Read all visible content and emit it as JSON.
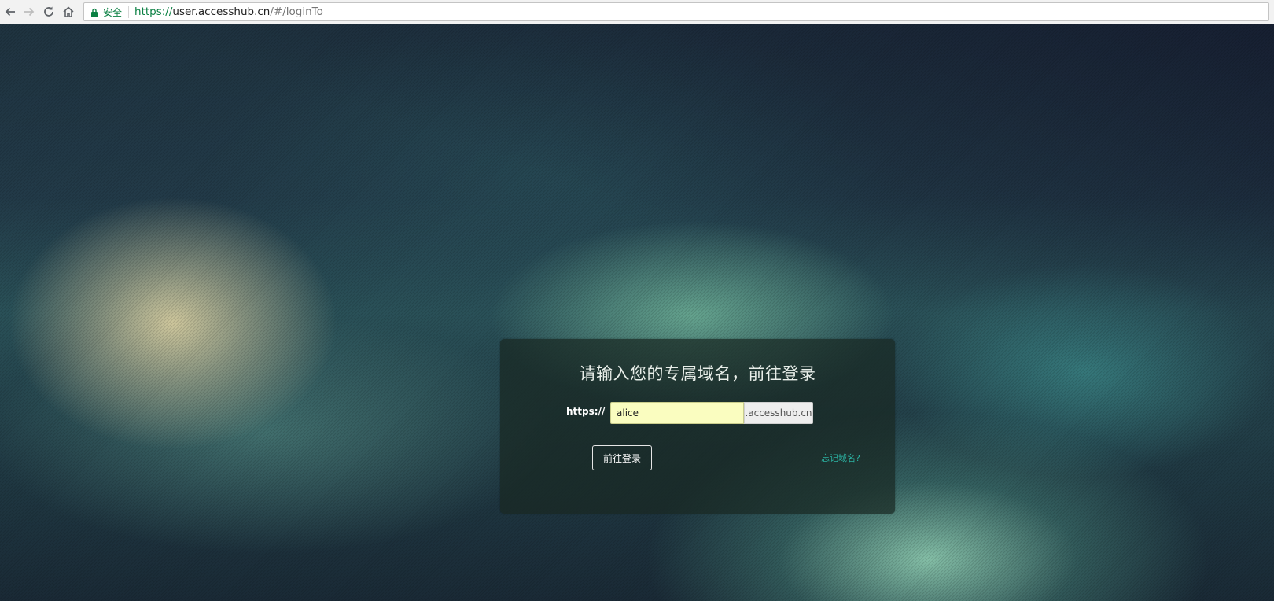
{
  "browser": {
    "secure_label": "安全",
    "url": {
      "scheme": "https://",
      "host": "user.accesshub.cn",
      "path": "/#/loginTo"
    },
    "icons": [
      "back-arrow-icon",
      "forward-arrow-icon",
      "reload-icon",
      "home-icon",
      "lock-icon"
    ],
    "secure_color": "#0b8043"
  },
  "login": {
    "title": "请输入您的专属域名，前往登录",
    "protocol_label": "https://",
    "domain_value": "alice",
    "domain_suffix": ".accesshub.cn",
    "submit_label": "前往登录",
    "forgot_label": "忘记域名?",
    "input_highlight_color": "#fafdc0",
    "link_color": "#2bb3a3"
  }
}
